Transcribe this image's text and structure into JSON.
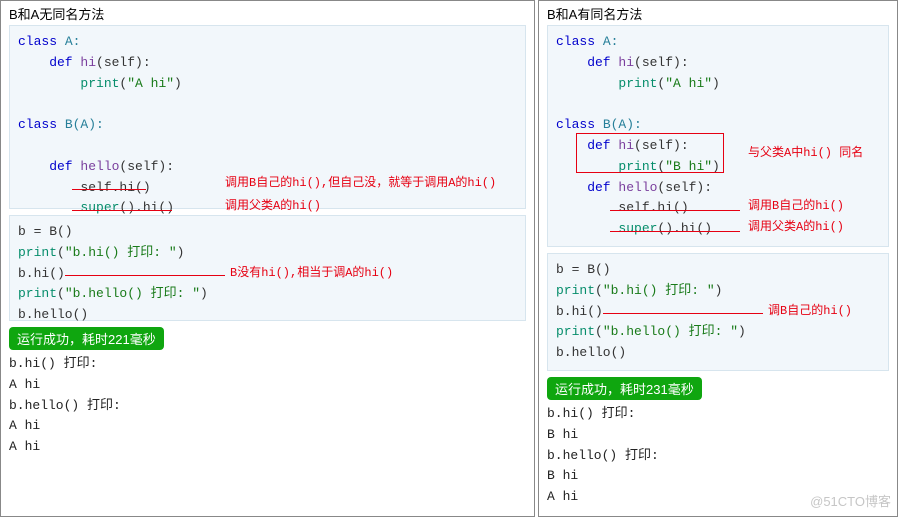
{
  "left": {
    "title": "B和A无同名方法",
    "code": {
      "l1a": "class",
      "l1b": " A:",
      "l2a": "    def",
      "l2b": " hi",
      "l2c": "(self):",
      "l3a": "        print",
      "l3b": "(",
      "l3c": "\"A hi\"",
      "l3d": ")",
      "blank": " ",
      "l4a": "class",
      "l4b": " B(A):",
      "l6a": "    def",
      "l6b": " hello",
      "l6c": "(self):",
      "l7a": "        self.hi()",
      "l8a": "        super",
      "l8b": "().hi()",
      "l10a": "b = B()",
      "l11a": "print",
      "l11b": "(",
      "l11c": "\"b.hi() 打印: \"",
      "l11d": ")",
      "l12a": "b.hi()",
      "l13a": "print",
      "l13b": "(",
      "l13c": "\"b.hello() 打印: \"",
      "l13d": ")",
      "l14a": "b.hello()"
    },
    "annot": {
      "a1": "调用B自己的hi(),但自己没，就等于调用A的hi()",
      "a2": "调用父类A的hi()",
      "a3": "B没有hi(),相当于调A的hi()"
    },
    "success": "运行成功，耗时221毫秒",
    "output": [
      "b.hi() 打印:",
      "A hi",
      "b.hello() 打印:",
      "A hi",
      "A hi"
    ]
  },
  "right": {
    "title": "B和A有同名方法",
    "code": {
      "l1a": "class",
      "l1b": " A:",
      "l2a": "    def",
      "l2b": " hi",
      "l2c": "(self):",
      "l3a": "        print",
      "l3b": "(",
      "l3c": "\"A hi\"",
      "l3d": ")",
      "blank": " ",
      "l4a": "class",
      "l4b": " B(A):",
      "l5a": "    def",
      "l5b": " hi",
      "l5c": "(self):",
      "l5d": "        print",
      "l5e": "(",
      "l5f": "\"B hi\"",
      "l5g": ")",
      "l6a": "    def",
      "l6b": " hello",
      "l6c": "(self):",
      "l7a": "        self.hi()",
      "l8a": "        super",
      "l8b": "().hi()",
      "l10a": "b = B()",
      "l11a": "print",
      "l11b": "(",
      "l11c": "\"b.hi() 打印: \"",
      "l11d": ")",
      "l12a": "b.hi()",
      "l13a": "print",
      "l13b": "(",
      "l13c": "\"b.hello() 打印: \"",
      "l13d": ")",
      "l14a": "b.hello()"
    },
    "annot": {
      "a1": "与父类A中hi() 同名",
      "a2": "调用B自己的hi()",
      "a3": "调用父类A的hi()",
      "a4": "调B自己的hi()"
    },
    "success": "运行成功，耗时231毫秒",
    "output": [
      "b.hi() 打印:",
      "B hi",
      "b.hello() 打印:",
      "B hi",
      "A hi"
    ]
  },
  "watermark": "@51CTO博客"
}
